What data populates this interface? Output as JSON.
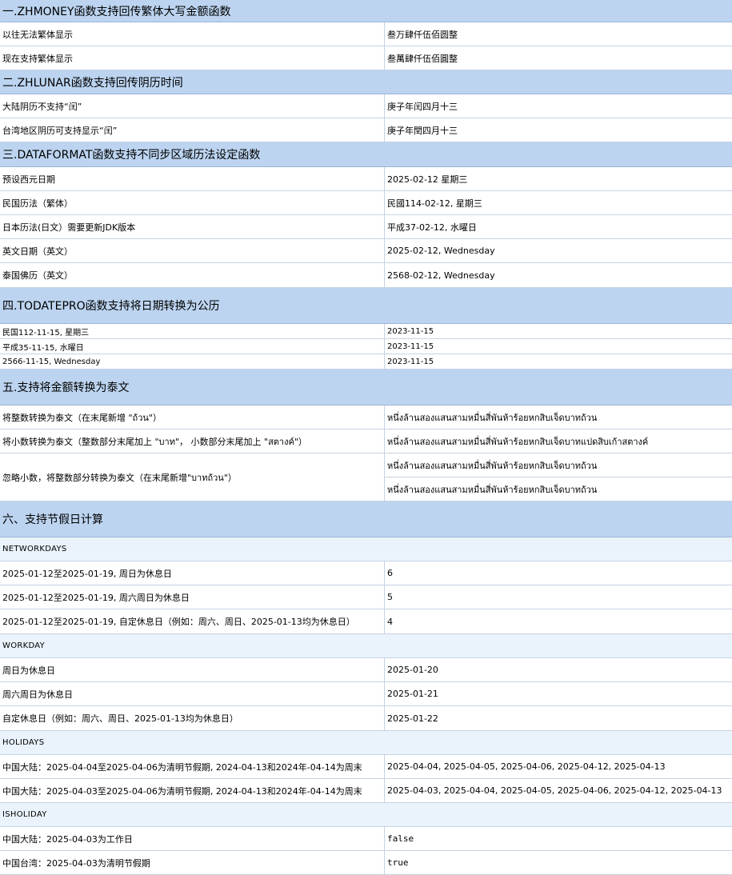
{
  "s1": {
    "title": "一.ZHMONEY函数支持回传繁体大写金额函数",
    "rows": [
      {
        "label": "以往无法繁体显示",
        "value": "叁万肆仟伍佰圆整"
      },
      {
        "label": "现在支持繁体显示",
        "value": "叁萬肆仟伍佰圓整"
      }
    ]
  },
  "s2": {
    "title": "二.ZHLUNAR函数支持回传阴历时间",
    "rows": [
      {
        "label": "大陆阴历不支持“闰”",
        "value": "庚子年闰四月十三"
      },
      {
        "label": "台湾地区阴历可支持显示“闰”",
        "value": "庚子年閏四月十三"
      }
    ]
  },
  "s3": {
    "title": "三.DATAFORMAT函数支持不同步区域历法设定函数",
    "rows": [
      {
        "label": "预设西元日期",
        "value": "2025-02-12 星期三"
      },
      {
        "label": "民国历法（繁体）",
        "value": "民國114-02-12, 星期三"
      },
      {
        "label": "日本历法(日文）需要更新JDK版本",
        "value": "平成37-02-12, 水曜日"
      },
      {
        "label": "英文日期（英文）",
        "value": "2025-02-12, Wednesday"
      },
      {
        "label": "泰国佛历（英文）",
        "value": "2568-02-12, Wednesday"
      }
    ]
  },
  "s4": {
    "title": "四.TODATEPRO函数支持将日期转换为公历",
    "rows": [
      {
        "label": "民国112-11-15, 星期三",
        "value": "2023-11-15"
      },
      {
        "label": "平成35-11-15, 水曜日",
        "value": "2023-11-15"
      },
      {
        "label": "2566-11-15, Wednesday",
        "value": "2023-11-15"
      }
    ]
  },
  "s5": {
    "title": "五.支持将金额转换为泰文",
    "rows": [
      {
        "label": "将整数转换为泰文（在末尾新增 \"ถ้วน\"）",
        "value": "หนึ่งล้านสองแสนสามหมื่นสี่พันห้าร้อยหกสิบเจ็ดบาทถ้วน"
      },
      {
        "label": "将小数转换为泰文（整数部分末尾加上 \"บาท\"， 小数部分末尾加上 \"สตางค์\"）",
        "value": "หนึ่งล้านสองแสนสามหมื่นสี่พันห้าร้อยหกสิบเจ็ดบาทแปดสิบเก้าสตางค์"
      }
    ],
    "merged_label": "忽略小数，将整数部分转换为泰文（在末尾新增\"บาทถ้วน\"）",
    "merged_values": [
      "หนึ่งล้านสองแสนสามหมื่นสี่พันห้าร้อยหกสิบเจ็ดบาทถ้วน",
      "หนึ่งล้านสองแสนสามหมื่นสี่พันห้าร้อยหกสิบเจ็ดบาทถ้วน"
    ]
  },
  "s6": {
    "title": "六、支持节假日计算",
    "networkdays": {
      "label": "NETWORKDAYS",
      "rows": [
        {
          "label": "2025-01-12至2025-01-19, 周日为休息日",
          "value": "6"
        },
        {
          "label": "2025-01-12至2025-01-19, 周六周日为休息日",
          "value": "5"
        },
        {
          "label": "2025-01-12至2025-01-19, 自定休息日（例如：周六、周日、2025-01-13均为休息日）",
          "value": "4"
        }
      ]
    },
    "workday": {
      "label": "WORKDAY",
      "rows": [
        {
          "label": "周日为休息日",
          "value": "2025-01-20"
        },
        {
          "label": "周六周日为休息日",
          "value": "2025-01-21"
        },
        {
          "label": "自定休息日（例如：周六、周日、2025-01-13均为休息日）",
          "value": "2025-01-22"
        }
      ]
    },
    "holidays": {
      "label": "HOLIDAYS",
      "rows": [
        {
          "label": "中国大陆：2025-04-04至2025-04-06为清明节假期, 2024-04-13和2024年-04-14为周末",
          "value": "2025-04-04, 2025-04-05, 2025-04-06, 2025-04-12, 2025-04-13"
        },
        {
          "label": "中国大陆：2025-04-03至2025-04-06为清明节假期, 2024-04-13和2024年-04-14为周末",
          "value": "2025-04-03, 2025-04-04, 2025-04-05, 2025-04-06, 2025-04-12, 2025-04-13"
        }
      ]
    },
    "isholiday": {
      "label": "ISHOLIDAY",
      "rows": [
        {
          "label": "中国大陆：2025-04-03为工作日",
          "value": "false"
        },
        {
          "label": "中国台湾：2025-04-03为清明节假期",
          "value": "true"
        }
      ]
    }
  }
}
